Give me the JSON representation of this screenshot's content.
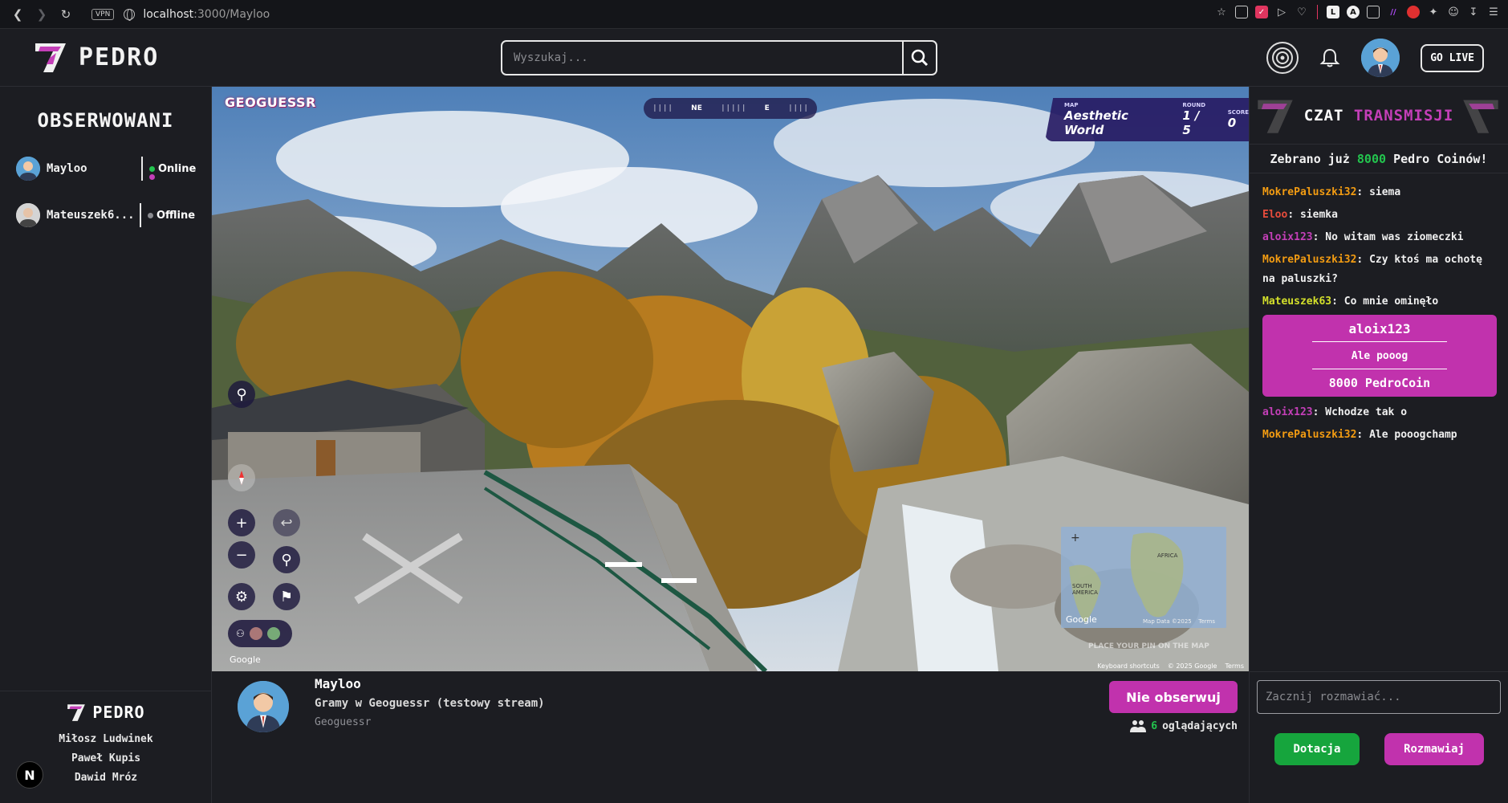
{
  "browser": {
    "url_host": "localhost",
    "url_path": ":3000/Mayloo",
    "vpn_label": "VPN"
  },
  "header": {
    "logo_text": "PEDRO",
    "search_placeholder": "Wyszukaj...",
    "golive_label": "GO LIVE"
  },
  "sidebar": {
    "title": "OBSERWOWANI",
    "followed": [
      {
        "name": "Mayloo",
        "status": "Online",
        "status_color": "#23c44e"
      },
      {
        "name": "Mateuszek6...",
        "status": "Offline",
        "status_color": "#8a8b90"
      }
    ],
    "footer": {
      "logo_text": "PEDRO",
      "authors": [
        "Miłosz Ludwinek",
        "Paweł Kupis",
        "Dawid Mróz"
      ],
      "badge": "N"
    }
  },
  "video": {
    "game_logo": "GEOGUESSR",
    "compass": [
      "NE",
      "E"
    ],
    "map_info": {
      "map_label": "MAP",
      "map_value": "Aesthetic World",
      "round_label": "ROUND",
      "round_value": "1 / 5",
      "score_label": "SCORE",
      "score_value": "0"
    },
    "minimap_labels": [
      "AFRICA",
      "SOUTH AMERICA"
    ],
    "minimap_footer": [
      "Map Data ©2025",
      "Terms"
    ],
    "minimap_google": "Google",
    "place_pin_hint": "PLACE YOUR PIN ON THE MAP",
    "footer": [
      "Keyboard shortcuts",
      "© 2025 Google",
      "Terms"
    ],
    "watermark": "Google"
  },
  "stream": {
    "streamer": "Mayloo",
    "title": "Gramy w Geoguessr (testowy stream)",
    "category": "Geoguessr",
    "unfollow_label": "Nie obserwuj",
    "viewer_count": "6",
    "viewer_suffix": "oglądających"
  },
  "chat": {
    "title_part1": "CZAT",
    "title_part2": "TRANSMISJI",
    "banner_prefix": "Zebrano już",
    "banner_amount": "8000",
    "banner_suffix": "Pedro Coinów!",
    "messages_before": [
      {
        "user": "MokrePaluszki32",
        "color": "#f39c12",
        "text": "siema"
      },
      {
        "user": "Eloo",
        "color": "#e74c3c",
        "text": "siemka"
      },
      {
        "user": "aloix123",
        "color": "#c43fb8",
        "text": "No witam was ziomeczki"
      },
      {
        "user": "MokrePaluszki32",
        "color": "#f39c12",
        "text": "Czy ktoś ma ochotę na paluszki?"
      },
      {
        "user": "Mateuszek63",
        "color": "#d4e02b",
        "text": "Co mnie ominęło"
      }
    ],
    "donation": {
      "user": "aloix123",
      "message": "Ale pooog",
      "amount": "8000 PedroCoin"
    },
    "messages_after": [
      {
        "user": "aloix123",
        "color": "#c43fb8",
        "text": "Wchodze tak o"
      },
      {
        "user": "MokrePaluszki32",
        "color": "#f39c12",
        "text": "Ale pooogchamp"
      }
    ],
    "input_placeholder": "Zacznij rozmawiać...",
    "donate_label": "Dotacja",
    "chat_label": "Rozmawiaj"
  }
}
